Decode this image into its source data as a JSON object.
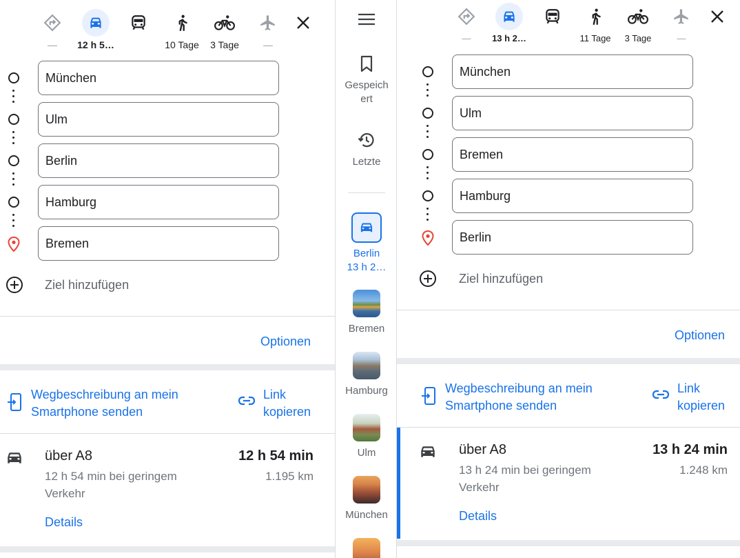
{
  "left": {
    "modes": [
      {
        "name": "best",
        "label": "—"
      },
      {
        "name": "car",
        "label": "12 h 5…"
      },
      {
        "name": "transit",
        "label": ""
      },
      {
        "name": "walk",
        "label": "10 Tage"
      },
      {
        "name": "bike",
        "label": "3 Tage"
      },
      {
        "name": "flight",
        "label": "—"
      }
    ],
    "stops": [
      "München",
      "Ulm",
      "Berlin",
      "Hamburg",
      "Bremen"
    ],
    "add_destination": "Ziel hinzufügen",
    "options": "Optionen",
    "send_to_phone": [
      "Wegbeschreibung an mein",
      "Smartphone senden"
    ],
    "copy_link": [
      "Link",
      "kopieren"
    ],
    "route": {
      "via": "über A8",
      "time": "12 h 54 min",
      "traffic": [
        "12 h 54 min bei geringem",
        "Verkehr"
      ],
      "distance": "1.195 km",
      "details": "Details"
    }
  },
  "middle": {
    "menu_icon": "hamburger-menu-icon",
    "saved": [
      "Gespeich",
      "ert"
    ],
    "recent": "Letzte",
    "active": [
      "Berlin",
      "13 h 2…"
    ],
    "places": [
      "Bremen",
      "Hamburg",
      "Ulm",
      "München"
    ]
  },
  "right": {
    "modes": [
      {
        "name": "best",
        "label": "—"
      },
      {
        "name": "car",
        "label": "13 h 2…"
      },
      {
        "name": "transit",
        "label": ""
      },
      {
        "name": "walk",
        "label": "11 Tage"
      },
      {
        "name": "bike",
        "label": "3 Tage"
      },
      {
        "name": "flight",
        "label": "—"
      }
    ],
    "stops": [
      "München",
      "Ulm",
      "Bremen",
      "Hamburg",
      "Berlin"
    ],
    "add_destination": "Ziel hinzufügen",
    "options": "Optionen",
    "send_to_phone": [
      "Wegbeschreibung an mein",
      "Smartphone senden"
    ],
    "copy_link": [
      "Link",
      "kopieren"
    ],
    "route": {
      "via": "über A8",
      "time": "13 h 24 min",
      "traffic": [
        "13 h 24 min bei geringem",
        "Verkehr"
      ],
      "distance": "1.248 km",
      "details": "Details"
    }
  },
  "colors": {
    "accent": "#1a73e8",
    "pin": "#ea4335",
    "selected_bg": "#e8f0fe"
  }
}
